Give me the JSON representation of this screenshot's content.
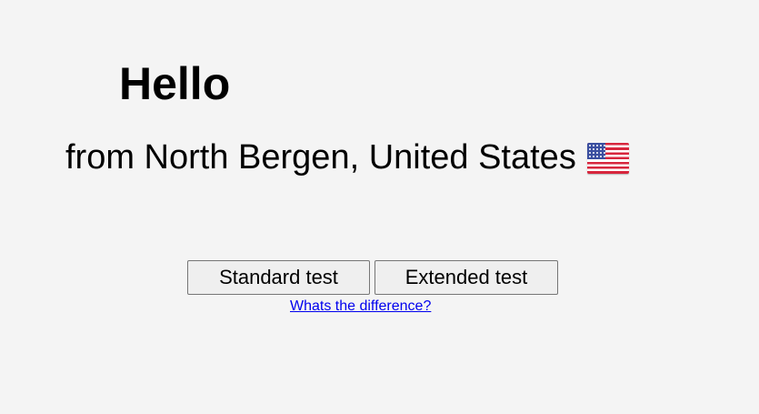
{
  "greeting": {
    "title": "Hello",
    "location_text": "from North Bergen, United States",
    "flag_icon": "us-flag-icon"
  },
  "actions": {
    "standard_label": "Standard test",
    "extended_label": "Extended test",
    "difference_link": "Whats the difference?"
  },
  "colors": {
    "background": "#f4f4f4",
    "link": "#0000ee",
    "button_bg": "#efefef",
    "button_border": "#767676"
  }
}
